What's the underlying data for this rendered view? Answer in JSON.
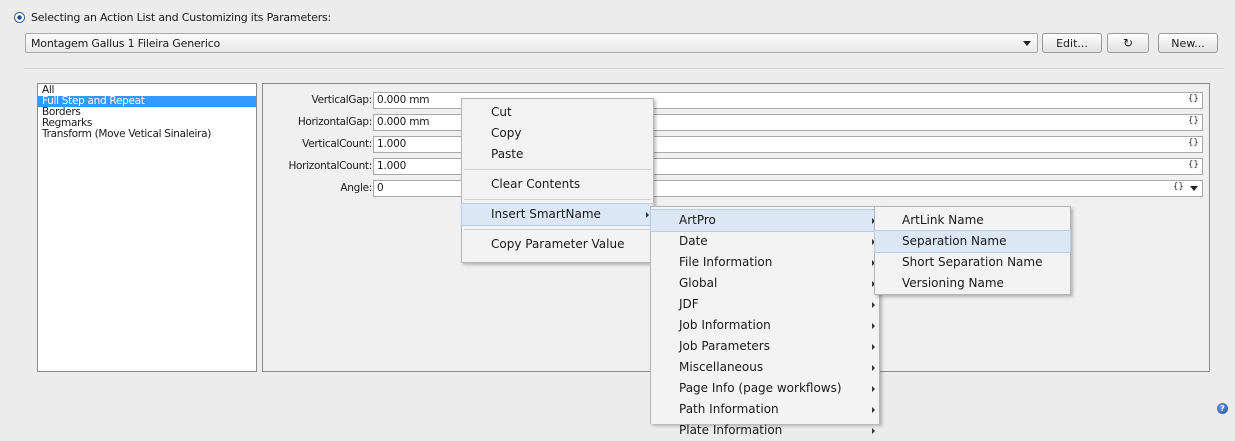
{
  "section": {
    "title": "Selecting an Action List and Customizing its Parameters:"
  },
  "action_list": {
    "selected": "Montagem Gallus 1 Fileira Generico"
  },
  "toolbar": {
    "edit_label": "Edit...",
    "refresh_label": "↻",
    "new_label": "New..."
  },
  "actions": {
    "items": [
      "All",
      "Full Step and Repeat",
      "Borders",
      "Regmarks",
      "Transform (Move Vetical Sinaleira)"
    ],
    "selected_index": 1
  },
  "parameters": [
    {
      "label": "VerticalGap:",
      "value": "0.000 mm",
      "braces": "{}"
    },
    {
      "label": "HorizontalGap:",
      "value": "0.000 mm",
      "braces": "{}"
    },
    {
      "label": "VerticalCount:",
      "value": "1.000",
      "braces": "{}"
    },
    {
      "label": "HorizontalCount:",
      "value": "1.000",
      "braces": "{}"
    },
    {
      "label": "Angle:",
      "value": "0",
      "braces": "{}"
    }
  ],
  "context_menu": {
    "cut": "Cut",
    "copy": "Copy",
    "paste": "Paste",
    "clear": "Clear Contents",
    "insert_smartname": "Insert SmartName",
    "copy_param": "Copy Parameter Value"
  },
  "smartname_menu": {
    "items": [
      "ArtPro",
      "Date",
      "File Information",
      "Global",
      "JDF",
      "Job Information",
      "Job Parameters",
      "Miscellaneous",
      "Page Info (page workflows)",
      "Path Information",
      "Plate Information"
    ]
  },
  "artpro_menu": {
    "items": [
      "ArtLink Name",
      "Separation Name",
      "Short Separation Name",
      "Versioning Name"
    ],
    "highlighted_index": 1
  },
  "help": {
    "glyph": "?"
  },
  "colors": {
    "selection": "#3399ff",
    "menu_highlight": "#dce7f5"
  }
}
